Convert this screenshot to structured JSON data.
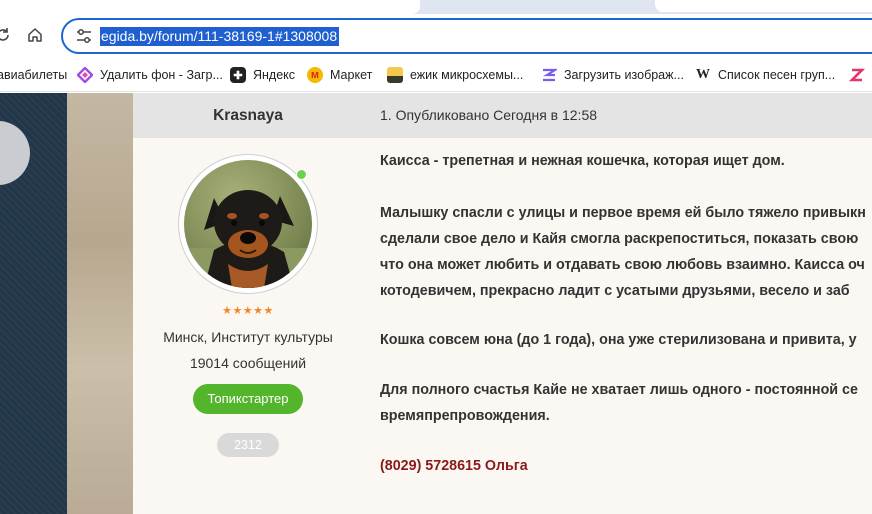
{
  "browser": {
    "url_selected": "egida.by/forum/111-38169-1#1308008",
    "bookmarks": [
      {
        "label": "авиабилеты",
        "icon": "none"
      },
      {
        "label": "Удалить фон - Загр...",
        "icon": "diamond-logo-icon"
      },
      {
        "label": "Яндекс",
        "icon": "plus-app-icon"
      },
      {
        "label": "Маркет",
        "icon": "market-logo-icon"
      },
      {
        "label": "ежик микросхемы...",
        "icon": "image-thumb-icon"
      },
      {
        "label": "Загрузить изображ...",
        "icon": "stripes-logo-icon"
      },
      {
        "label": "Список песен груп...",
        "icon": "wikipedia-icon"
      }
    ],
    "wikipedia_glyph": "W"
  },
  "post": {
    "author": "Krasnaya",
    "date_line": "1. Опубликовано Сегодня в 12:58",
    "profile": {
      "stars": "★★★★★",
      "rating": 5,
      "location": "Минск, Институт культуры",
      "messages": "19014 сообщений",
      "role_badge": "Топикстартер",
      "number_badge": "2312",
      "online_color": "#6ad24f"
    },
    "content": {
      "p1": "Каисса - трепетная и нежная кошечка, которая ищет дом.",
      "p2_l1": "Малышку спасли с улицы и первое время ей было тяжело привыкн",
      "p2_l2": "сделали свое дело и Кайя смогла раскрепоститься, показать свою",
      "p2_l3": "что она может любить и отдавать свою любовь взаимно. Каисса оч",
      "p2_l4": "котодевичем, прекрасно ладит с усатыми друзьями, весело и заб",
      "p3": "Кошка совсем юна (до 1 года), она уже стерилизована и привита, у",
      "p4_l1": "Для полного счастья Кайе не хватает лишь одного - постоянной се",
      "p4_l2": "времяпрепровождения.",
      "phone": "(8029) 5728615 Ольга"
    }
  },
  "colors": {
    "accent_url": "#1f5fd0",
    "badge_green": "#52b52c",
    "phone_red": "#8a1a1a",
    "header_gray": "#e4e4e4"
  }
}
